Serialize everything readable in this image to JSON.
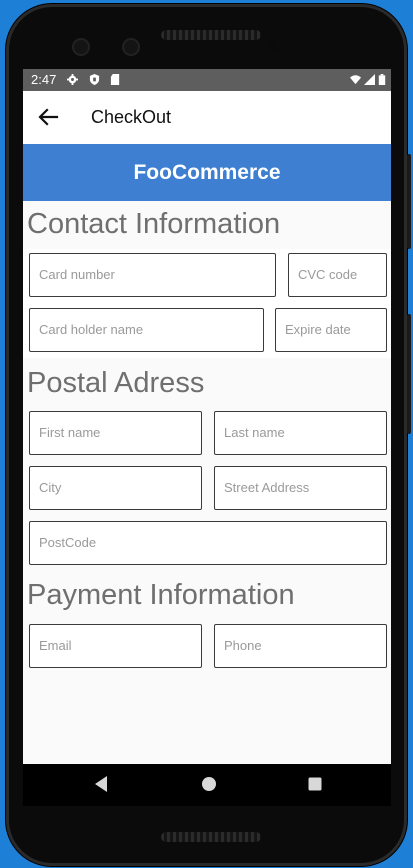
{
  "status_bar": {
    "time": "2:47",
    "icons": [
      "settings-icon",
      "shield-icon",
      "sd-card-icon",
      "wifi-icon",
      "signal-icon",
      "battery-icon"
    ]
  },
  "app_bar": {
    "title": "CheckOut",
    "back_icon": "arrow-left-icon"
  },
  "brand": {
    "title": "FooCommerce",
    "color": "#3e7fd1"
  },
  "sections": {
    "contact": {
      "title": "Contact Information",
      "card_number": "Card number",
      "cvc": "CVC code",
      "holder": "Card holder name",
      "expire": "Expire date"
    },
    "postal": {
      "title": "Postal Adress",
      "first_name": "First name",
      "last_name": "Last name",
      "city": "City",
      "street": "Street Address",
      "postcode": "PostCode"
    },
    "payment": {
      "title": "Payment Information",
      "email": "Email",
      "phone": "Phone"
    }
  },
  "nav_bar": {
    "icons": [
      "nav-back-icon",
      "nav-home-icon",
      "nav-recent-icon"
    ]
  }
}
